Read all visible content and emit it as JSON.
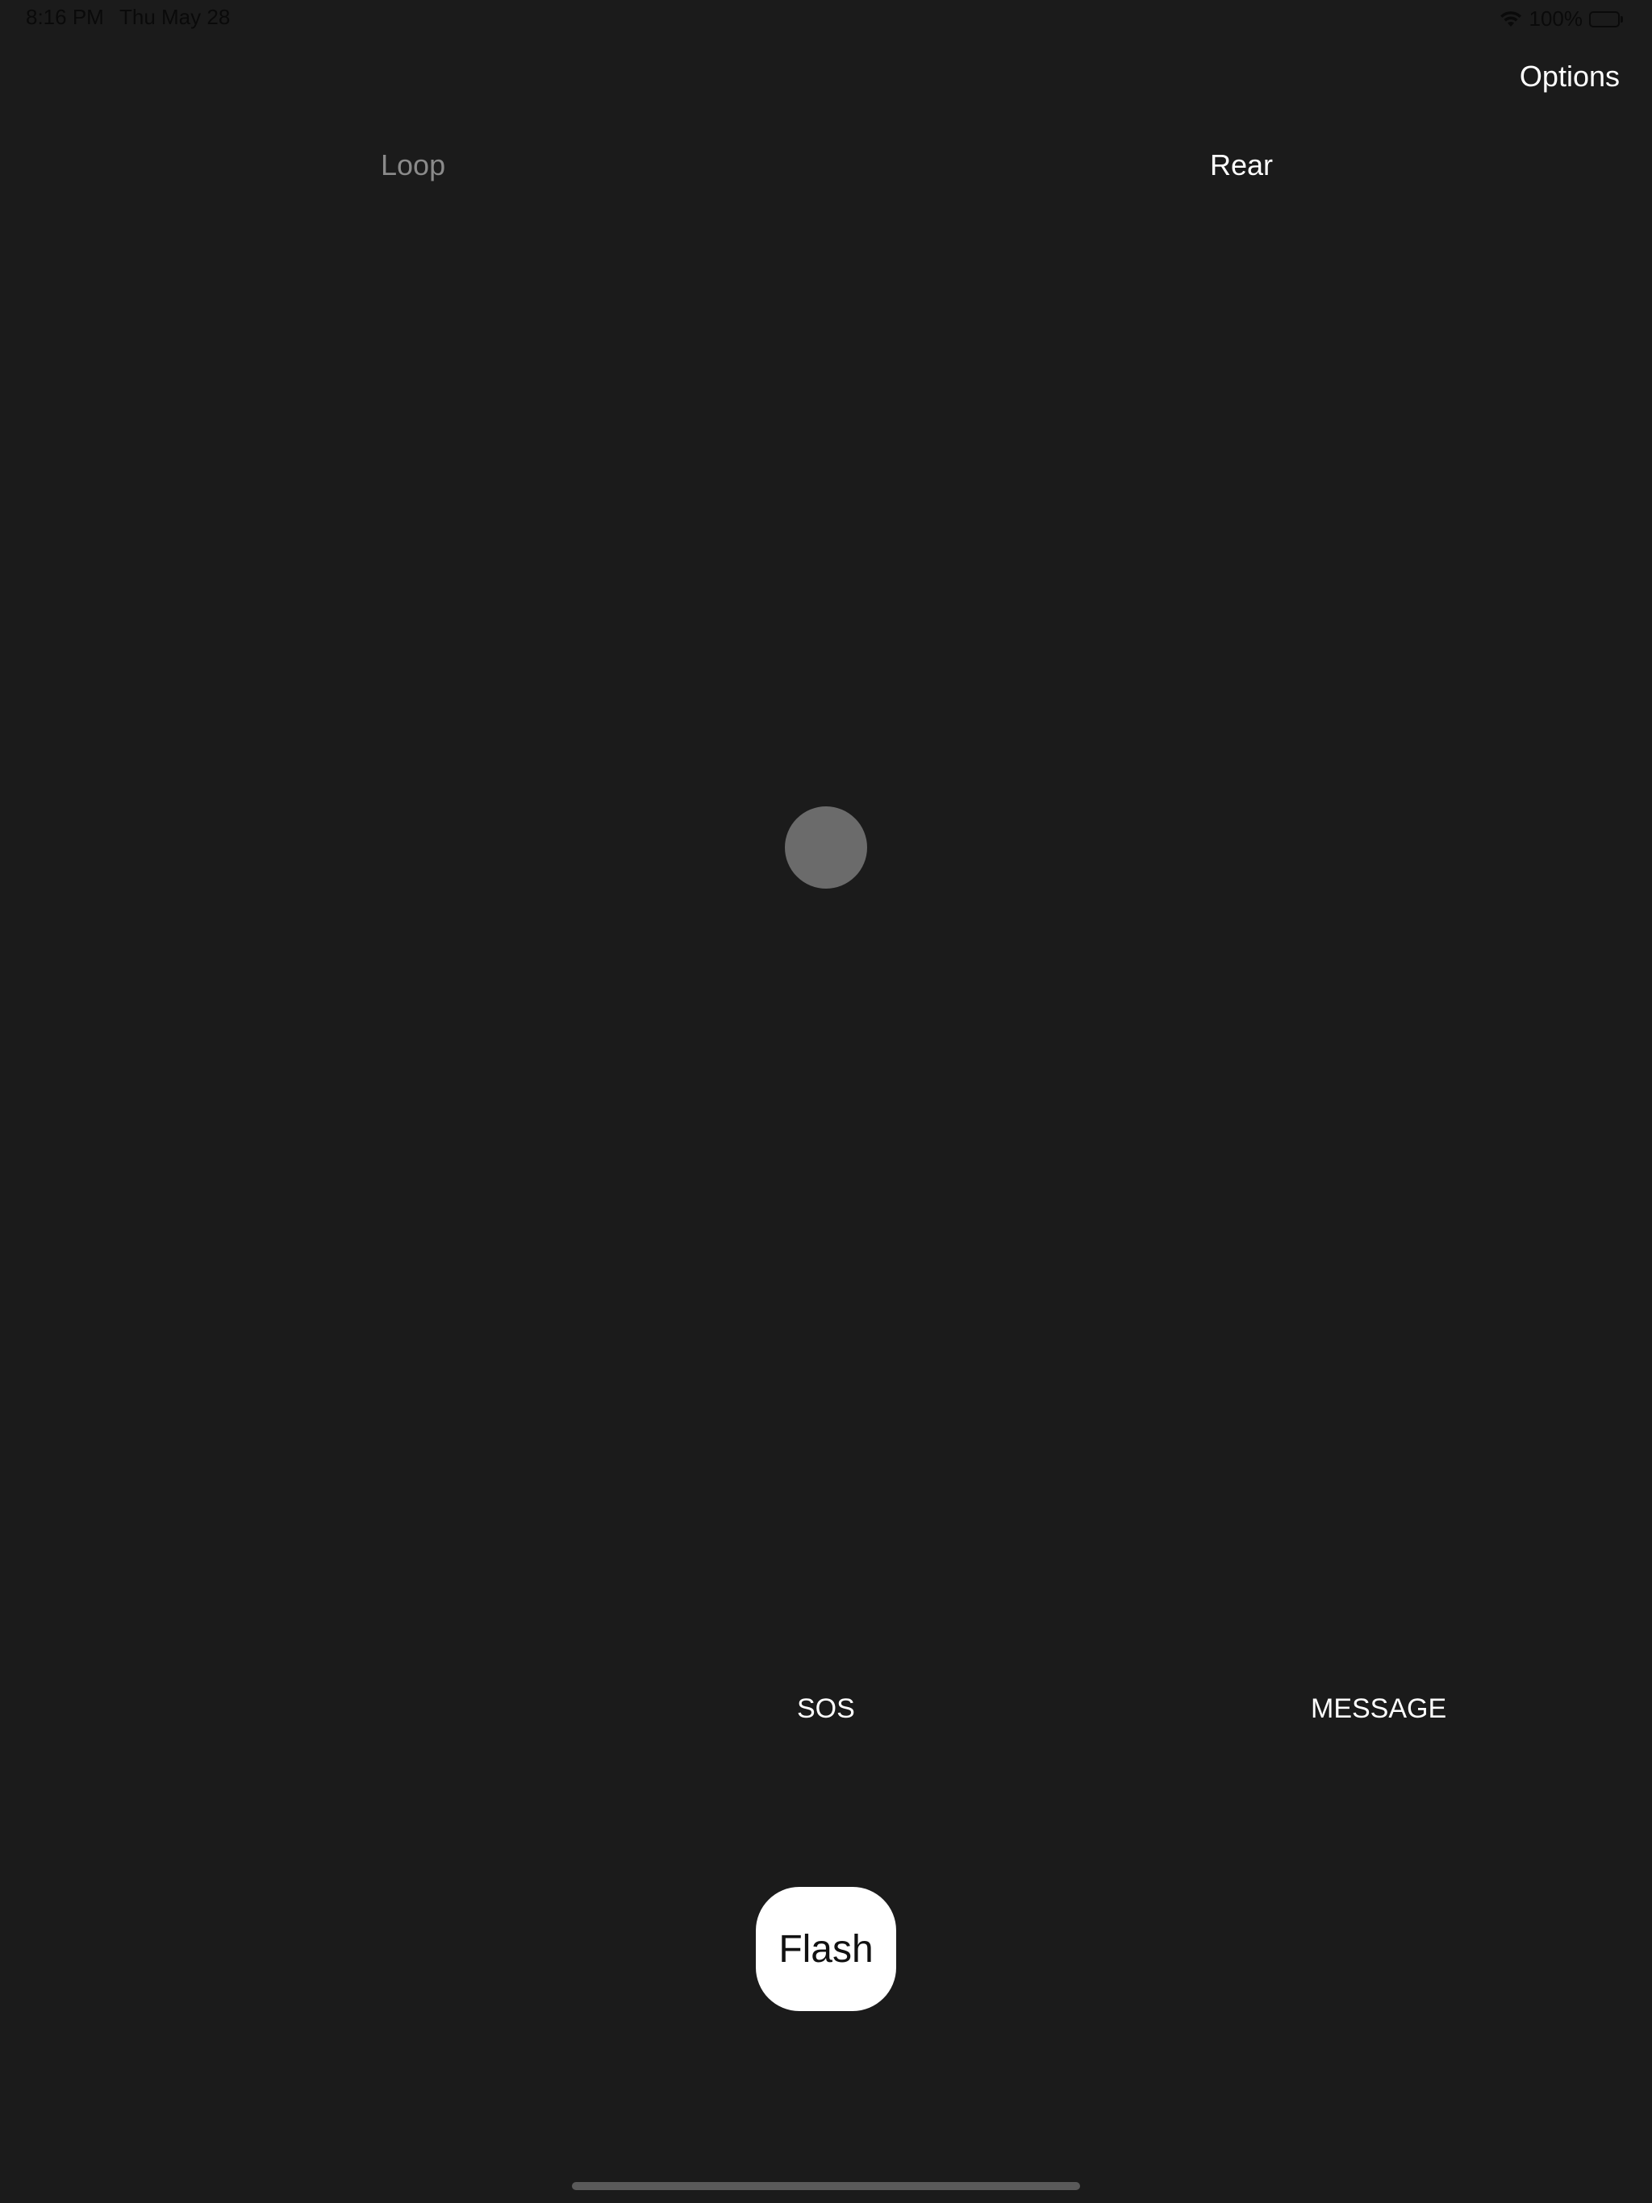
{
  "status_bar": {
    "time": "8:16 PM",
    "date": "Thu May 28",
    "battery_text": "100%",
    "wifi_icon": "wifi-icon",
    "battery_icon": "battery-icon"
  },
  "header": {
    "options_label": "Options"
  },
  "tabs": {
    "loop_label": "Loop",
    "rear_label": "Rear",
    "active": "Rear"
  },
  "indicator": {
    "icon": "status-dot",
    "color": "#6b6b6b"
  },
  "modes": {
    "sos_label": "SOS",
    "message_label": "MESSAGE"
  },
  "flash": {
    "label": "Flash"
  },
  "theme": {
    "background": "#1b1b1b",
    "text": "#ffffff",
    "inactive_text": "#8a8a8a",
    "button_bg": "#ffffff"
  }
}
